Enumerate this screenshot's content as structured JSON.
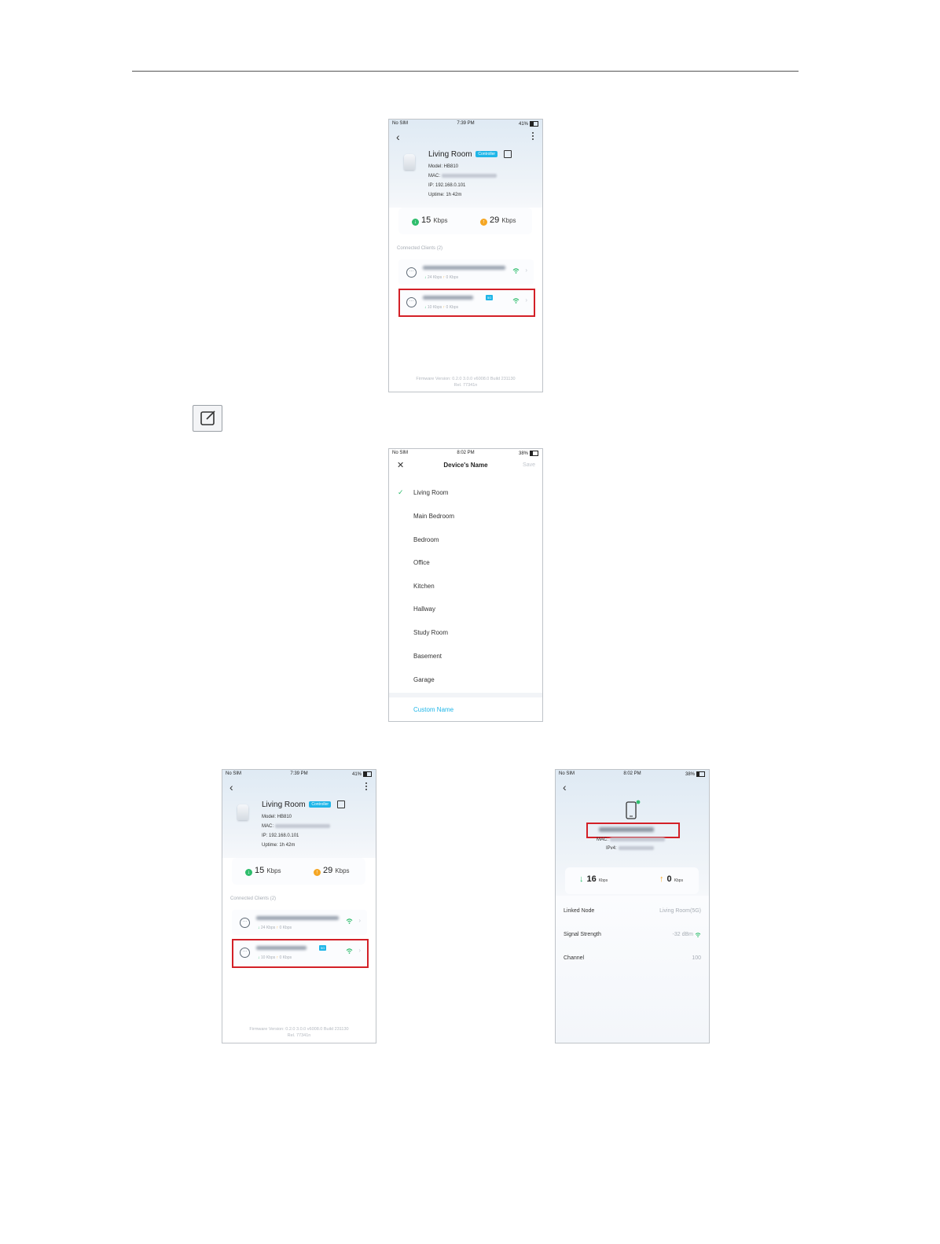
{
  "screen1": {
    "status": {
      "carrier": "No SIM",
      "time": "7:39 PM",
      "battery": "41%"
    },
    "device_name": "Living Room",
    "badge": "Controller",
    "model_label": "Model: HB810",
    "mac_label": "MAC:",
    "ip_label": "IP: 192.168.0.101",
    "uptime_label": "Uptime: 1h 42m",
    "download": {
      "value": "15",
      "unit": "Kbps"
    },
    "upload": {
      "value": "29",
      "unit": "Kbps"
    },
    "section_title": "Connected Clients (2)",
    "clients": [
      {
        "traffic": "24 Kbps",
        "traffic2": "0 Kbps",
        "link_badge": ""
      },
      {
        "traffic": "10 Kbps",
        "traffic2": "0 Kbps",
        "link_badge": "5G"
      }
    ],
    "firmware_line1": "Firmware Version: 0.2.0 3.0.0 v6008.0 Build 231130",
    "firmware_line2": "Rel. 77341n"
  },
  "screen2": {
    "status": {
      "carrier": "No SIM",
      "time": "8:02 PM",
      "battery": "38%"
    },
    "title": "Device's Name",
    "save_label": "Save",
    "options": [
      "Living Room",
      "Main Bedroom",
      "Bedroom",
      "Office",
      "Kitchen",
      "Hallway",
      "Study Room",
      "Basement",
      "Garage"
    ],
    "custom_label": "Custom Name"
  },
  "screen3": {
    "status": {
      "carrier": "No SIM",
      "time": "7:39 PM",
      "battery": "41%"
    },
    "device_name": "Living Room",
    "badge": "Controller",
    "model_label": "Model: HB810",
    "mac_label": "MAC:",
    "ip_label": "IP: 192.168.0.101",
    "uptime_label": "Uptime: 1h 42m",
    "download": {
      "value": "15",
      "unit": "Kbps"
    },
    "upload": {
      "value": "29",
      "unit": "Kbps"
    },
    "section_title": "Connected Clients (2)",
    "clients": [
      {
        "traffic": "24 Kbps",
        "traffic2": "0 Kbps",
        "link_badge": ""
      },
      {
        "traffic": "10 Kbps",
        "traffic2": "0 Kbps",
        "link_badge": "5G"
      }
    ],
    "firmware_line1": "Firmware Version: 0.2.0 3.0.0 v6008.0 Build 231130",
    "firmware_line2": "Rel. 77341n"
  },
  "screen4": {
    "status": {
      "carrier": "No SIM",
      "time": "8:02 PM",
      "battery": "38%"
    },
    "mac_label": "MAC:",
    "ipv4_label": "IPv4:",
    "download": {
      "value": "16",
      "unit": "Kbps"
    },
    "upload": {
      "value": "0",
      "unit": "Kbps"
    },
    "rows": [
      {
        "label": "Linked Node",
        "value": "Living Room(5G)"
      },
      {
        "label": "Signal Strength",
        "value": "-32 dBm"
      },
      {
        "label": "Channel",
        "value": "100"
      }
    ]
  },
  "colors": {
    "accent": "#1fb6e8",
    "download": "#2ebd6c",
    "upload": "#f5a623",
    "highlight": "#d32027"
  }
}
